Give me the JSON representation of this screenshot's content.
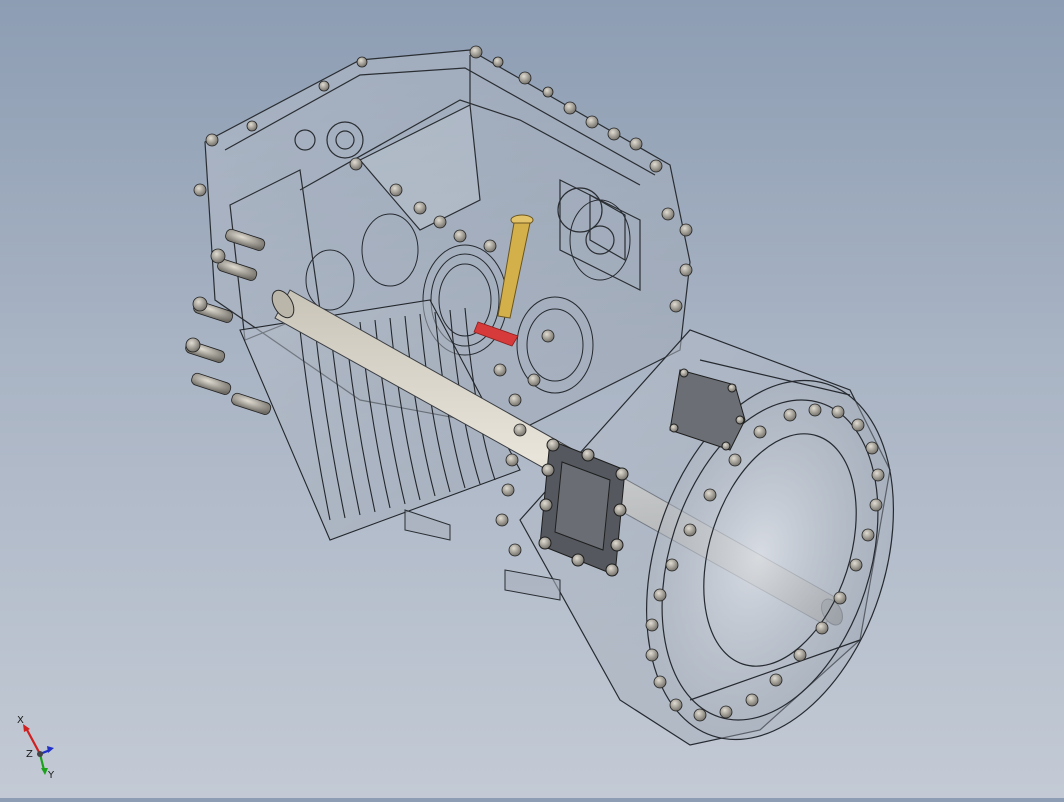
{
  "viewport": {
    "background_top": "#8d9db3",
    "background_bottom": "#c3cad5"
  },
  "model": {
    "name": "transmission-gearbox-assembly",
    "display": "transparent-wireframe",
    "line_color": "#2a2e33",
    "highlight_colors": {
      "dipstick": "#d4b04a",
      "marker": "#d63a3a",
      "cover_plate": "#4e5258"
    }
  },
  "triad": {
    "axes": [
      {
        "name": "x",
        "label": "X",
        "color": "#d02020"
      },
      {
        "name": "y",
        "label": "Y",
        "color": "#1aa31a"
      },
      {
        "name": "z",
        "label": "Z",
        "color": "#2030c8"
      }
    ]
  }
}
